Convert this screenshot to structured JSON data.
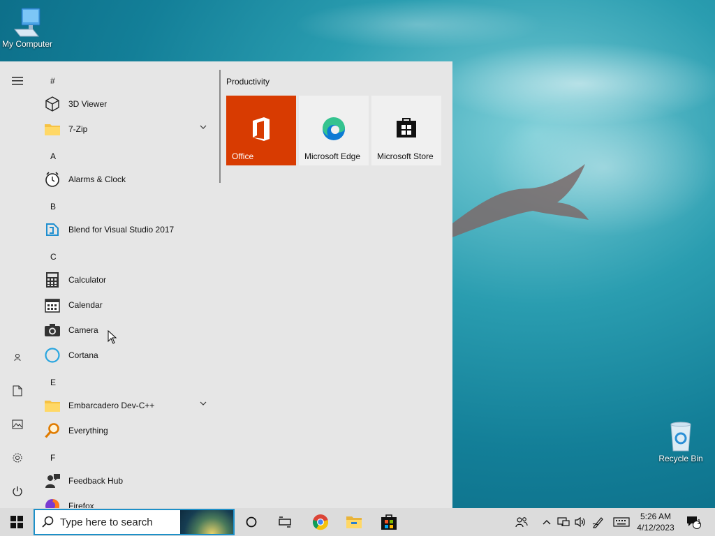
{
  "desktop": {
    "icons": [
      {
        "label": "My Computer",
        "icon": "computer-icon"
      },
      {
        "label": "Recycle Bin",
        "icon": "recycle-bin-icon"
      }
    ]
  },
  "start_menu": {
    "rail": [
      {
        "name": "hamburger-menu-icon"
      },
      {
        "name": "user-icon"
      },
      {
        "name": "documents-icon"
      },
      {
        "name": "pictures-icon"
      },
      {
        "name": "settings-gear-icon"
      },
      {
        "name": "power-icon"
      }
    ],
    "letters": [
      "#",
      "A",
      "B",
      "C",
      "E",
      "F"
    ],
    "apps": [
      {
        "label": "3D Viewer",
        "icon": "cube-icon"
      },
      {
        "label": "7-Zip",
        "icon": "folder-icon",
        "expandable": true
      },
      {
        "label": "Alarms & Clock",
        "icon": "clock-icon"
      },
      {
        "label": "Blend for Visual Studio 2017",
        "icon": "blend-icon"
      },
      {
        "label": "Calculator",
        "icon": "calculator-icon"
      },
      {
        "label": "Calendar",
        "icon": "calendar-icon"
      },
      {
        "label": "Camera",
        "icon": "camera-icon"
      },
      {
        "label": "Cortana",
        "icon": "cortana-ring-icon"
      },
      {
        "label": "Embarcadero Dev-C++",
        "icon": "folder-icon",
        "expandable": true
      },
      {
        "label": "Everything",
        "icon": "magnifier-icon"
      },
      {
        "label": "Feedback Hub",
        "icon": "feedback-icon"
      },
      {
        "label": "Firefox",
        "icon": "firefox-icon"
      }
    ],
    "tiles_group": "Productivity",
    "tiles": [
      {
        "label": "Office",
        "icon": "office-icon",
        "color": "#d83b01"
      },
      {
        "label": "Microsoft Edge",
        "icon": "edge-icon"
      },
      {
        "label": "Microsoft Store",
        "icon": "store-icon"
      }
    ]
  },
  "taskbar": {
    "search_placeholder": "Type here to search",
    "time": "5:26 AM",
    "date": "4/12/2023",
    "notification_count": "1"
  },
  "colors": {
    "office_tile": "#d83b01",
    "search_border": "#1e90c8",
    "start_bg": "#e6e6e6",
    "taskbar_bg": "#dcdcdc"
  }
}
